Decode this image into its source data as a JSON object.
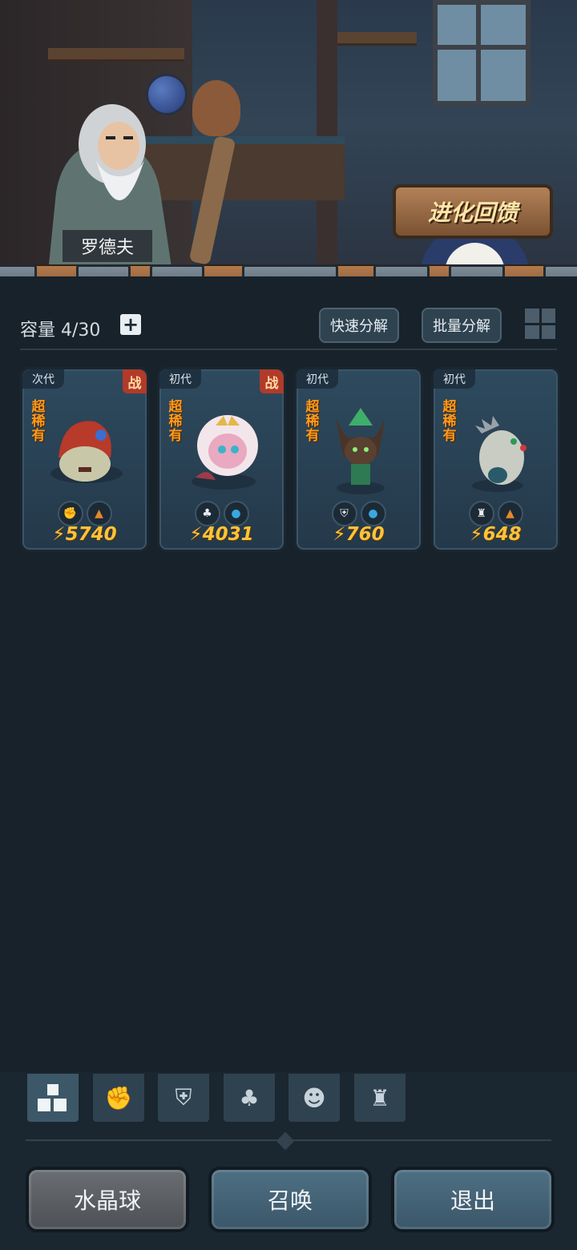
{
  "npc": {
    "name": "罗德夫"
  },
  "evolution_sign": {
    "label": "进化回馈"
  },
  "toolbar": {
    "capacity_label": "容量 4/30",
    "plus_icon": "+",
    "quick_decompose": "快速分解",
    "batch_decompose": "批量分解"
  },
  "cards": [
    {
      "generation": "次代",
      "battle_badge": "战",
      "rarity": "超稀有",
      "skills": [
        "fist-icon",
        "earth-icon"
      ],
      "power": "5740",
      "color": "#b83a2a"
    },
    {
      "generation": "初代",
      "battle_badge": "战",
      "rarity": "超稀有",
      "skills": [
        "sprout-icon",
        "water-icon"
      ],
      "power": "4031",
      "color": "#e9a9c0"
    },
    {
      "generation": "初代",
      "battle_badge": "",
      "rarity": "超稀有",
      "skills": [
        "shield-icon",
        "water-icon"
      ],
      "power": "760",
      "color": "#4a3428"
    },
    {
      "generation": "初代",
      "battle_badge": "",
      "rarity": "超稀有",
      "skills": [
        "tower-icon",
        "earth-icon"
      ],
      "power": "648",
      "color": "#c8ccc2"
    }
  ],
  "filters": [
    "all-icon",
    "fist-icon",
    "shield-icon",
    "sprout-icon",
    "alien-icon",
    "tower-icon"
  ],
  "buttons": {
    "crystal_ball": "水晶球",
    "summon": "召唤",
    "exit": "退出"
  }
}
